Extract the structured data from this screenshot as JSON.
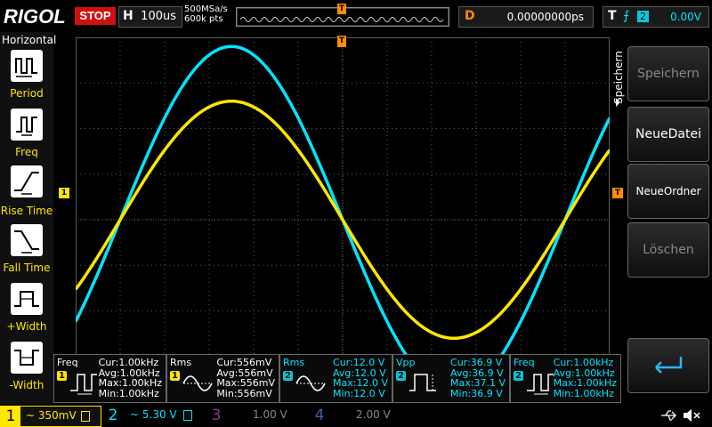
{
  "topbar": {
    "logo": "RIGOL",
    "run_state": "STOP",
    "h_label": "H",
    "timebase": "100us",
    "sample_rate": "500MSa/s",
    "memory_depth": "600k pts",
    "delay_label": "D",
    "delay_value": "0.00000000ps",
    "trigger_label": "T",
    "trigger_icon": "rising-edge-icon",
    "trigger_source": "2",
    "trigger_level": "0.00V"
  },
  "left_menu": {
    "title": "Horizontal",
    "items": [
      {
        "label": "Period",
        "icon": "period-icon"
      },
      {
        "label": "Freq",
        "icon": "freq-icon"
      },
      {
        "label": "Rise Time",
        "icon": "rise-time-icon"
      },
      {
        "label": "Fall Time",
        "icon": "fall-time-icon"
      },
      {
        "label": "+Width",
        "icon": "positive-width-icon"
      },
      {
        "label": "-Width",
        "icon": "negative-width-icon"
      }
    ]
  },
  "right_menu": {
    "title": "Speichern",
    "buttons": [
      {
        "label": "Speichern",
        "enabled": false
      },
      {
        "label": "NeueDatei",
        "enabled": true
      },
      {
        "label": "NeueOrdner",
        "enabled": true
      },
      {
        "label": "Löschen",
        "enabled": false
      },
      {
        "label": "",
        "icon": "return-icon",
        "enabled": true
      }
    ]
  },
  "markers": {
    "ch1_ref": "1",
    "trigger_pos": "T",
    "trigger_level": "T"
  },
  "colors": {
    "ch1": "#ffe600",
    "ch2": "#00e5ff",
    "trigger": "#ff8c00",
    "grid": "#5a5a5a"
  },
  "waveforms": {
    "ch1": {
      "shape": "sine",
      "cycles_visible": 1,
      "peak_divisions": 2.6,
      "phase": "inverted"
    },
    "ch2": {
      "shape": "sine",
      "cycles_visible": 1,
      "peak_divisions": 3.8,
      "phase": "inverted"
    }
  },
  "measurements": [
    {
      "name": "Freq",
      "channel": "1",
      "cur": "Cur:1.00kHz",
      "avg": "Avg:1.00kHz",
      "max": "Max:1.00kHz",
      "min": "Min:1.00kHz"
    },
    {
      "name": "Rms",
      "channel": "1",
      "cur": "Cur:556mV",
      "avg": "Avg:556mV",
      "max": "Max:556mV",
      "min": "Min:556mV"
    },
    {
      "name": "Rms",
      "channel": "2",
      "cur": "Cur:12.0 V",
      "avg": "Avg:12.0 V",
      "max": "Max:12.0 V",
      "min": "Min:12.0 V"
    },
    {
      "name": "Vpp",
      "channel": "2",
      "cur": "Cur:36.9 V",
      "avg": "Avg:36.9 V",
      "max": "Max:37.1 V",
      "min": "Min:36.9 V"
    },
    {
      "name": "Freq",
      "channel": "2",
      "cur": "Cur:1.00kHz",
      "avg": "Avg:1.00kHz",
      "max": "Max:1.00kHz",
      "min": "Min:1.00kHz"
    }
  ],
  "channels": [
    {
      "num": "1",
      "scale": "~ 350mV",
      "active": true
    },
    {
      "num": "2",
      "scale": "~ 5.30 V",
      "active": true
    },
    {
      "num": "3",
      "scale": "1.00 V",
      "active": false
    },
    {
      "num": "4",
      "scale": "2.00 V",
      "active": false
    }
  ],
  "status_icons": [
    "usb-icon",
    "speaker-muted-icon"
  ]
}
